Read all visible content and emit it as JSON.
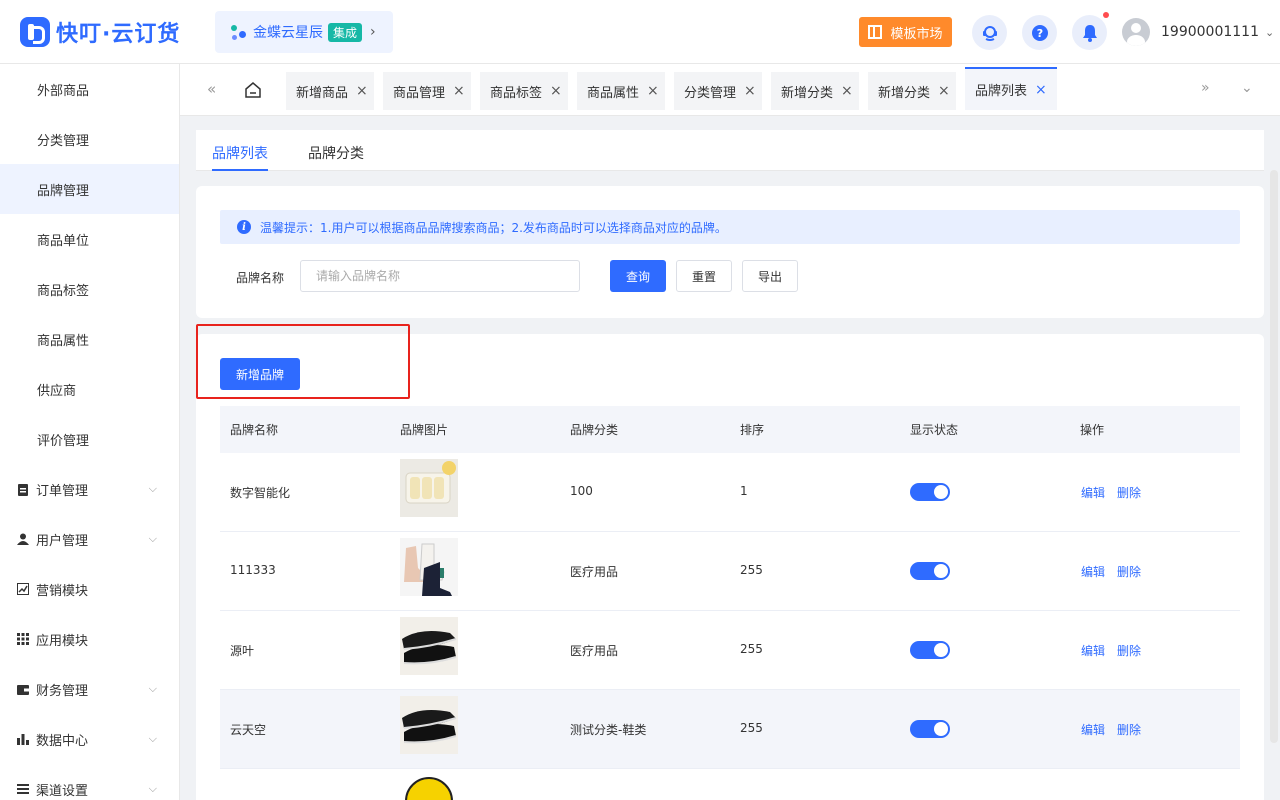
{
  "header": {
    "logo_text": "快叮·云订货",
    "kd_name": "金蝶云星辰",
    "kd_badge": "集成",
    "market_label": "模板市场",
    "phone": "19900001111"
  },
  "sidebar": {
    "items": [
      {
        "label": "外部商品"
      },
      {
        "label": "分类管理"
      },
      {
        "label": "品牌管理",
        "active": true
      },
      {
        "label": "商品单位"
      },
      {
        "label": "商品标签"
      },
      {
        "label": "商品属性"
      },
      {
        "label": "供应商"
      },
      {
        "label": "评价管理"
      }
    ],
    "groups": [
      {
        "label": "订单管理",
        "icon": "clipboard-icon"
      },
      {
        "label": "用户管理",
        "icon": "user-icon"
      },
      {
        "label": "营销模块",
        "icon": "trend-chart-icon"
      },
      {
        "label": "应用模块",
        "icon": "grid-icon"
      },
      {
        "label": "财务管理",
        "icon": "wallet-icon"
      },
      {
        "label": "数据中心",
        "icon": "bar-chart-icon"
      },
      {
        "label": "渠道设置",
        "icon": "settings-icon"
      }
    ]
  },
  "tabs": [
    {
      "label": "新增商品"
    },
    {
      "label": "商品管理"
    },
    {
      "label": "商品标签"
    },
    {
      "label": "商品属性"
    },
    {
      "label": "分类管理"
    },
    {
      "label": "新增分类"
    },
    {
      "label": "新增分类"
    },
    {
      "label": "品牌列表",
      "active": true
    }
  ],
  "subtabs": [
    {
      "label": "品牌列表",
      "active": true
    },
    {
      "label": "品牌分类"
    }
  ],
  "tip": "温馨提示：1.用户可以根据商品品牌搜索商品；2.发布商品时可以选择商品对应的品牌。",
  "search": {
    "label": "品牌名称",
    "placeholder": "请输入品牌名称",
    "query_btn": "查询",
    "reset_btn": "重置",
    "export_btn": "导出"
  },
  "add_btn": "新增品牌",
  "table": {
    "headers": [
      "品牌名称",
      "品牌图片",
      "品牌分类",
      "排序",
      "显示状态",
      "操作"
    ],
    "rows": [
      {
        "name": "数字智能化",
        "category": "100",
        "sort": "1",
        "image": "food-box-image"
      },
      {
        "name": "111333",
        "category": "医疗用品",
        "sort": "255",
        "image": "boots-image"
      },
      {
        "name": "源叶",
        "category": "医疗用品",
        "sort": "255",
        "image": "slip-on-shoes-image"
      },
      {
        "name": "云天空",
        "category": "测试分类-鞋类",
        "sort": "255",
        "image": "slip-on-shoes-image"
      }
    ],
    "edit_label": "编辑",
    "delete_label": "删除"
  }
}
